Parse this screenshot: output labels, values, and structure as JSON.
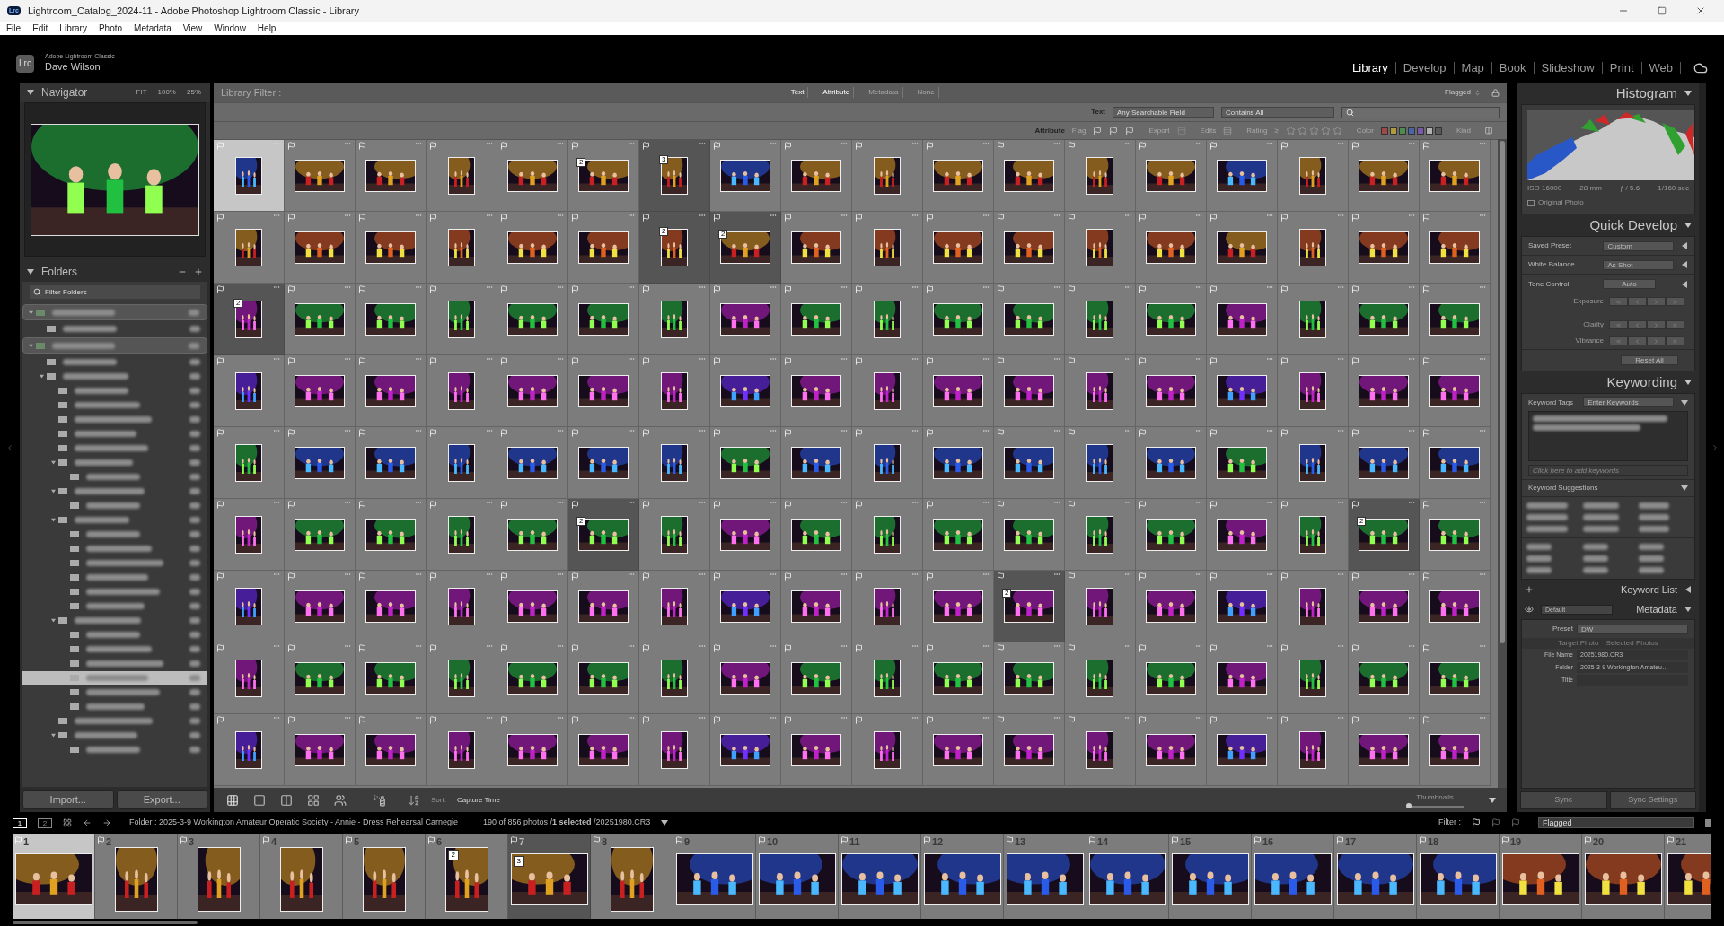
{
  "window": {
    "app_icon": "Lrc",
    "title": "Lightroom_Catalog_2024-11 - Adobe Photoshop Lightroom Classic - Library"
  },
  "menu": [
    "File",
    "Edit",
    "Library",
    "Photo",
    "Metadata",
    "View",
    "Window",
    "Help"
  ],
  "identity": {
    "logo": "Lrc",
    "product": "Adobe Lightroom Classic",
    "user": "Dave Wilson"
  },
  "modules": [
    {
      "label": "Library",
      "selected": true
    },
    {
      "label": "Develop",
      "selected": false
    },
    {
      "label": "Map",
      "selected": false
    },
    {
      "label": "Book",
      "selected": false
    },
    {
      "label": "Slideshow",
      "selected": false
    },
    {
      "label": "Print",
      "selected": false
    },
    {
      "label": "Web",
      "selected": false
    }
  ],
  "navigator": {
    "title": "Navigator",
    "zoom_options": [
      "FIT",
      "100%",
      "25%"
    ]
  },
  "folders": {
    "title": "Folders",
    "filter_placeholder": "Filter Folders",
    "tree": [
      {
        "kind": "drive",
        "selected": false,
        "children": [
          {
            "kind": "folder",
            "selected": false
          }
        ]
      },
      {
        "kind": "drive",
        "selected": false,
        "children": [
          {
            "kind": "folder",
            "selected": false
          },
          {
            "kind": "folder",
            "selected": false,
            "children": [
              {
                "kind": "folder",
                "selected": false
              },
              {
                "kind": "folder",
                "selected": false
              },
              {
                "kind": "folder",
                "selected": false
              },
              {
                "kind": "folder",
                "selected": false
              },
              {
                "kind": "folder",
                "selected": false
              },
              {
                "kind": "folder",
                "selected": false,
                "children": [
                  {
                    "kind": "folder",
                    "selected": false
                  }
                ]
              },
              {
                "kind": "folder",
                "selected": false,
                "children": [
                  {
                    "kind": "folder",
                    "selected": false
                  }
                ]
              },
              {
                "kind": "folder",
                "selected": false,
                "children": [
                  {
                    "kind": "folder",
                    "selected": false
                  },
                  {
                    "kind": "folder",
                    "selected": false
                  },
                  {
                    "kind": "folder",
                    "selected": false
                  },
                  {
                    "kind": "folder",
                    "selected": false
                  },
                  {
                    "kind": "folder",
                    "selected": false
                  },
                  {
                    "kind": "folder",
                    "selected": false
                  }
                ]
              },
              {
                "kind": "folder",
                "selected": false,
                "children": [
                  {
                    "kind": "folder",
                    "selected": false
                  },
                  {
                    "kind": "folder",
                    "selected": false
                  },
                  {
                    "kind": "folder",
                    "selected": false
                  },
                  {
                    "kind": "folder",
                    "selected": true
                  },
                  {
                    "kind": "folder",
                    "selected": false
                  },
                  {
                    "kind": "folder",
                    "selected": false
                  }
                ]
              },
              {
                "kind": "folder",
                "selected": false
              },
              {
                "kind": "folder",
                "selected": false,
                "children": [
                  {
                    "kind": "folder",
                    "selected": false
                  }
                ]
              }
            ]
          }
        ]
      }
    ]
  },
  "left_buttons": [
    "Import...",
    "Export..."
  ],
  "library_filter": {
    "title": "Library Filter :",
    "tabs": [
      {
        "label": "Text",
        "selected": true
      },
      {
        "label": "Attribute",
        "selected": true
      },
      {
        "label": "Metadata",
        "selected": false
      },
      {
        "label": "None",
        "selected": false
      }
    ],
    "preset": "Flagged",
    "text_row": {
      "label": "Text",
      "field": "Any Searchable Field",
      "rule": "Contains All"
    },
    "attribute_row": {
      "label": "Attribute",
      "flag_label": "Flag",
      "export_label": "Export",
      "edits_label": "Edits",
      "rating_label": "Rating",
      "rating_op": "≥",
      "stars": 0,
      "color_label": "Color",
      "colors": [
        {
          "color": "#a04848"
        },
        {
          "color": "#b09a40"
        },
        {
          "color": "#4c8c4c"
        },
        {
          "color": "#4a64a8"
        },
        {
          "color": "#7a5aa8"
        },
        {
          "color": "#b0b0b0"
        },
        {
          "color": "#585858"
        }
      ],
      "kind_label": "Kind"
    }
  },
  "grid": {
    "rows": [
      {
        "cells": [
          {
            "selected": true,
            "in_stack": false
          },
          {
            "selected": false,
            "in_stack": false
          },
          {
            "selected": false,
            "in_stack": false
          },
          {
            "selected": false,
            "in_stack": false
          },
          {
            "selected": false,
            "in_stack": false
          },
          {
            "selected": false,
            "in_stack": false,
            "stack": "2"
          },
          {
            "selected": false,
            "in_stack": true,
            "stack": "3"
          },
          {
            "selected": false,
            "in_stack": false
          },
          {
            "selected": false,
            "in_stack": false
          },
          {
            "selected": false,
            "in_stack": false
          },
          {
            "selected": false,
            "in_stack": false
          },
          {
            "selected": false,
            "in_stack": false
          },
          {
            "selected": false,
            "in_stack": false
          },
          {
            "selected": false,
            "in_stack": false
          },
          {
            "selected": false,
            "in_stack": false
          },
          {
            "selected": false,
            "in_stack": false
          },
          {
            "selected": false,
            "in_stack": false
          },
          {
            "selected": false,
            "in_stack": false
          }
        ]
      },
      {
        "cells": [
          {
            "selected": false,
            "in_stack": false
          },
          {
            "selected": false,
            "in_stack": false
          },
          {
            "selected": false,
            "in_stack": false
          },
          {
            "selected": false,
            "in_stack": false
          },
          {
            "selected": false,
            "in_stack": false
          },
          {
            "selected": false,
            "in_stack": false
          },
          {
            "selected": false,
            "in_stack": true,
            "stack": "2"
          },
          {
            "selected": false,
            "in_stack": true,
            "stack": "2"
          },
          {
            "selected": false,
            "in_stack": false
          },
          {
            "selected": false,
            "in_stack": false
          },
          {
            "selected": false,
            "in_stack": false
          },
          {
            "selected": false,
            "in_stack": false
          },
          {
            "selected": false,
            "in_stack": false
          },
          {
            "selected": false,
            "in_stack": false
          },
          {
            "selected": false,
            "in_stack": false
          },
          {
            "selected": false,
            "in_stack": false
          },
          {
            "selected": false,
            "in_stack": false
          },
          {
            "selected": false,
            "in_stack": false
          }
        ]
      },
      {
        "cells": [
          {
            "selected": false,
            "in_stack": true,
            "stack": "2"
          },
          {
            "selected": false,
            "in_stack": false
          },
          {
            "selected": false,
            "in_stack": false
          },
          {
            "selected": false,
            "in_stack": false
          },
          {
            "selected": false,
            "in_stack": false
          },
          {
            "selected": false,
            "in_stack": false
          },
          {
            "selected": false,
            "in_stack": false
          },
          {
            "selected": false,
            "in_stack": false
          },
          {
            "selected": false,
            "in_stack": false
          },
          {
            "selected": false,
            "in_stack": false
          },
          {
            "selected": false,
            "in_stack": false
          },
          {
            "selected": false,
            "in_stack": false
          },
          {
            "selected": false,
            "in_stack": false
          },
          {
            "selected": false,
            "in_stack": false
          },
          {
            "selected": false,
            "in_stack": false
          },
          {
            "selected": false,
            "in_stack": false
          },
          {
            "selected": false,
            "in_stack": false
          },
          {
            "selected": false,
            "in_stack": false
          }
        ]
      },
      {
        "cells": [
          {
            "selected": false,
            "in_stack": false
          },
          {
            "selected": false,
            "in_stack": false
          },
          {
            "selected": false,
            "in_stack": false
          },
          {
            "selected": false,
            "in_stack": false
          },
          {
            "selected": false,
            "in_stack": false
          },
          {
            "selected": false,
            "in_stack": false
          },
          {
            "selected": false,
            "in_stack": false
          },
          {
            "selected": false,
            "in_stack": false
          },
          {
            "selected": false,
            "in_stack": false
          },
          {
            "selected": false,
            "in_stack": false
          },
          {
            "selected": false,
            "in_stack": false
          },
          {
            "selected": false,
            "in_stack": false
          },
          {
            "selected": false,
            "in_stack": false
          },
          {
            "selected": false,
            "in_stack": false
          },
          {
            "selected": false,
            "in_stack": false
          },
          {
            "selected": false,
            "in_stack": false
          },
          {
            "selected": false,
            "in_stack": false
          },
          {
            "selected": false,
            "in_stack": false
          }
        ]
      },
      {
        "cells": [
          {
            "selected": false,
            "in_stack": false
          },
          {
            "selected": false,
            "in_stack": false
          },
          {
            "selected": false,
            "in_stack": false
          },
          {
            "selected": false,
            "in_stack": false
          },
          {
            "selected": false,
            "in_stack": false
          },
          {
            "selected": false,
            "in_stack": false
          },
          {
            "selected": false,
            "in_stack": false
          },
          {
            "selected": false,
            "in_stack": false
          },
          {
            "selected": false,
            "in_stack": false
          },
          {
            "selected": false,
            "in_stack": false
          },
          {
            "selected": false,
            "in_stack": false
          },
          {
            "selected": false,
            "in_stack": false
          },
          {
            "selected": false,
            "in_stack": false
          },
          {
            "selected": false,
            "in_stack": false
          },
          {
            "selected": false,
            "in_stack": false
          },
          {
            "selected": false,
            "in_stack": false
          },
          {
            "selected": false,
            "in_stack": false
          },
          {
            "selected": false,
            "in_stack": false
          }
        ]
      },
      {
        "cells": [
          {
            "selected": false,
            "in_stack": false
          },
          {
            "selected": false,
            "in_stack": false
          },
          {
            "selected": false,
            "in_stack": false
          },
          {
            "selected": false,
            "in_stack": false
          },
          {
            "selected": false,
            "in_stack": false
          },
          {
            "selected": false,
            "in_stack": true,
            "stack": "2"
          },
          {
            "selected": false,
            "in_stack": false
          },
          {
            "selected": false,
            "in_stack": false
          },
          {
            "selected": false,
            "in_stack": false
          },
          {
            "selected": false,
            "in_stack": false
          },
          {
            "selected": false,
            "in_stack": false
          },
          {
            "selected": false,
            "in_stack": false
          },
          {
            "selected": false,
            "in_stack": false
          },
          {
            "selected": false,
            "in_stack": false
          },
          {
            "selected": false,
            "in_stack": false
          },
          {
            "selected": false,
            "in_stack": false
          },
          {
            "selected": false,
            "in_stack": true,
            "stack": "2"
          },
          {
            "selected": false,
            "in_stack": false
          }
        ]
      },
      {
        "cells": [
          {
            "selected": false,
            "in_stack": false
          },
          {
            "selected": false,
            "in_stack": false
          },
          {
            "selected": false,
            "in_stack": false
          },
          {
            "selected": false,
            "in_stack": false
          },
          {
            "selected": false,
            "in_stack": false
          },
          {
            "selected": false,
            "in_stack": false
          },
          {
            "selected": false,
            "in_stack": false
          },
          {
            "selected": false,
            "in_stack": false
          },
          {
            "selected": false,
            "in_stack": false
          },
          {
            "selected": false,
            "in_stack": false
          },
          {
            "selected": false,
            "in_stack": false
          },
          {
            "selected": false,
            "in_stack": true,
            "stack": "2"
          },
          {
            "selected": false,
            "in_stack": false
          },
          {
            "selected": false,
            "in_stack": false
          },
          {
            "selected": false,
            "in_stack": false
          },
          {
            "selected": false,
            "in_stack": false
          },
          {
            "selected": false,
            "in_stack": false
          },
          {
            "selected": false,
            "in_stack": false
          }
        ]
      },
      {
        "cells": [
          {
            "selected": false,
            "in_stack": false
          },
          {
            "selected": false,
            "in_stack": false
          },
          {
            "selected": false,
            "in_stack": false
          },
          {
            "selected": false,
            "in_stack": false
          },
          {
            "selected": false,
            "in_stack": false
          },
          {
            "selected": false,
            "in_stack": false
          },
          {
            "selected": false,
            "in_stack": false
          },
          {
            "selected": false,
            "in_stack": false
          },
          {
            "selected": false,
            "in_stack": false
          },
          {
            "selected": false,
            "in_stack": false
          },
          {
            "selected": false,
            "in_stack": false
          },
          {
            "selected": false,
            "in_stack": false
          },
          {
            "selected": false,
            "in_stack": false
          },
          {
            "selected": false,
            "in_stack": false
          },
          {
            "selected": false,
            "in_stack": false
          },
          {
            "selected": false,
            "in_stack": false
          },
          {
            "selected": false,
            "in_stack": false
          },
          {
            "selected": false,
            "in_stack": false
          }
        ]
      },
      {
        "cells": [
          {
            "selected": false,
            "in_stack": false
          },
          {
            "selected": false,
            "in_stack": false
          },
          {
            "selected": false,
            "in_stack": false
          },
          {
            "selected": false,
            "in_stack": false
          },
          {
            "selected": false,
            "in_stack": false
          },
          {
            "selected": false,
            "in_stack": false
          },
          {
            "selected": false,
            "in_stack": false
          },
          {
            "selected": false,
            "in_stack": false
          },
          {
            "selected": false,
            "in_stack": false
          },
          {
            "selected": false,
            "in_stack": false
          },
          {
            "selected": false,
            "in_stack": false
          },
          {
            "selected": false,
            "in_stack": false
          },
          {
            "selected": false,
            "in_stack": false
          },
          {
            "selected": false,
            "in_stack": false
          },
          {
            "selected": false,
            "in_stack": false
          },
          {
            "selected": false,
            "in_stack": false
          },
          {
            "selected": false,
            "in_stack": false
          },
          {
            "selected": false,
            "in_stack": false
          }
        ]
      }
    ]
  },
  "toolbar": {
    "sort_label": "Sort:",
    "sort_value": "Capture Time",
    "thumbnails_label": "Thumbnails",
    "thumbnail_size": {
      "level": 0.05
    }
  },
  "filmstrip_bar": {
    "screens": [
      {
        "label": "1",
        "selected": true
      },
      {
        "label": "2",
        "selected": false
      }
    ],
    "source": "Folder : 2025-3-9 Workington Amateur Operatic Society - Annie - Dress Rehearsal Carnegie",
    "count": "190 of 856 photos /**1 selected** /20251980.CR3",
    "filter_label": "Filter :",
    "filter_value": "Flagged"
  },
  "filmstrip": [
    {
      "number": "1",
      "selected": true,
      "in_stack": false
    },
    {
      "number": "2",
      "selected": false,
      "in_stack": false
    },
    {
      "number": "3",
      "selected": false,
      "in_stack": false
    },
    {
      "number": "4",
      "selected": false,
      "in_stack": false
    },
    {
      "number": "5",
      "selected": false,
      "in_stack": false
    },
    {
      "number": "6",
      "selected": false,
      "in_stack": false,
      "stack": "2"
    },
    {
      "number": "7",
      "selected": false,
      "in_stack": true,
      "stack": "3"
    },
    {
      "number": "8",
      "selected": false,
      "in_stack": false
    },
    {
      "number": "9",
      "selected": false,
      "in_stack": false
    },
    {
      "number": "10",
      "selected": false,
      "in_stack": false
    },
    {
      "number": "11",
      "selected": false,
      "in_stack": false
    },
    {
      "number": "12",
      "selected": false,
      "in_stack": false
    },
    {
      "number": "13",
      "selected": false,
      "in_stack": false
    },
    {
      "number": "14",
      "selected": false,
      "in_stack": false
    },
    {
      "number": "15",
      "selected": false,
      "in_stack": false
    },
    {
      "number": "16",
      "selected": false,
      "in_stack": false
    },
    {
      "number": "17",
      "selected": false,
      "in_stack": false
    },
    {
      "number": "18",
      "selected": false,
      "in_stack": false
    },
    {
      "number": "19",
      "selected": false,
      "in_stack": false
    },
    {
      "number": "20",
      "selected": false,
      "in_stack": false
    },
    {
      "number": "21",
      "selected": false,
      "in_stack": false
    }
  ],
  "histogram": {
    "title": "Histogram",
    "iso": "ISO 16000",
    "focal": "28 mm",
    "aperture": "ƒ / 5.6",
    "shutter": "1/160 sec",
    "original_photo": {
      "label": "Original Photo",
      "checked": false
    }
  },
  "quick_develop": {
    "title": "Quick Develop",
    "rows": [
      {
        "label": "Saved Preset",
        "value": "Custom"
      },
      {
        "label": "White Balance",
        "value": "As Shot"
      }
    ],
    "tone_control": {
      "label": "Tone Control",
      "auto": "Auto"
    },
    "adjustments": [
      "Exposure",
      "Clarity",
      "Vibrance"
    ],
    "reset": "Reset All"
  },
  "keywording": {
    "title": "Keywording",
    "tags_label": "Keyword Tags",
    "tags_mode": "Enter Keywords",
    "add_placeholder": "Click here to add keywords",
    "suggestions_title": "Keyword Suggestions"
  },
  "keyword_list": {
    "title": "Keyword List"
  },
  "metadata": {
    "title": "Metadata",
    "view": "Default",
    "preset_label": "Preset",
    "preset": "DW",
    "targets": [
      {
        "label": "Target Photo",
        "disabled": true
      },
      {
        "label": "Selected Photos",
        "disabled": true
      }
    ],
    "fields": [
      {
        "label": "File Name",
        "value": "20251980.CR3"
      },
      {
        "label": "Folder",
        "value": "2025-3-9 Workington Amateu…"
      },
      {
        "label": "Title"
      }
    ]
  },
  "sync": [
    "Sync",
    "Sync Settings"
  ]
}
